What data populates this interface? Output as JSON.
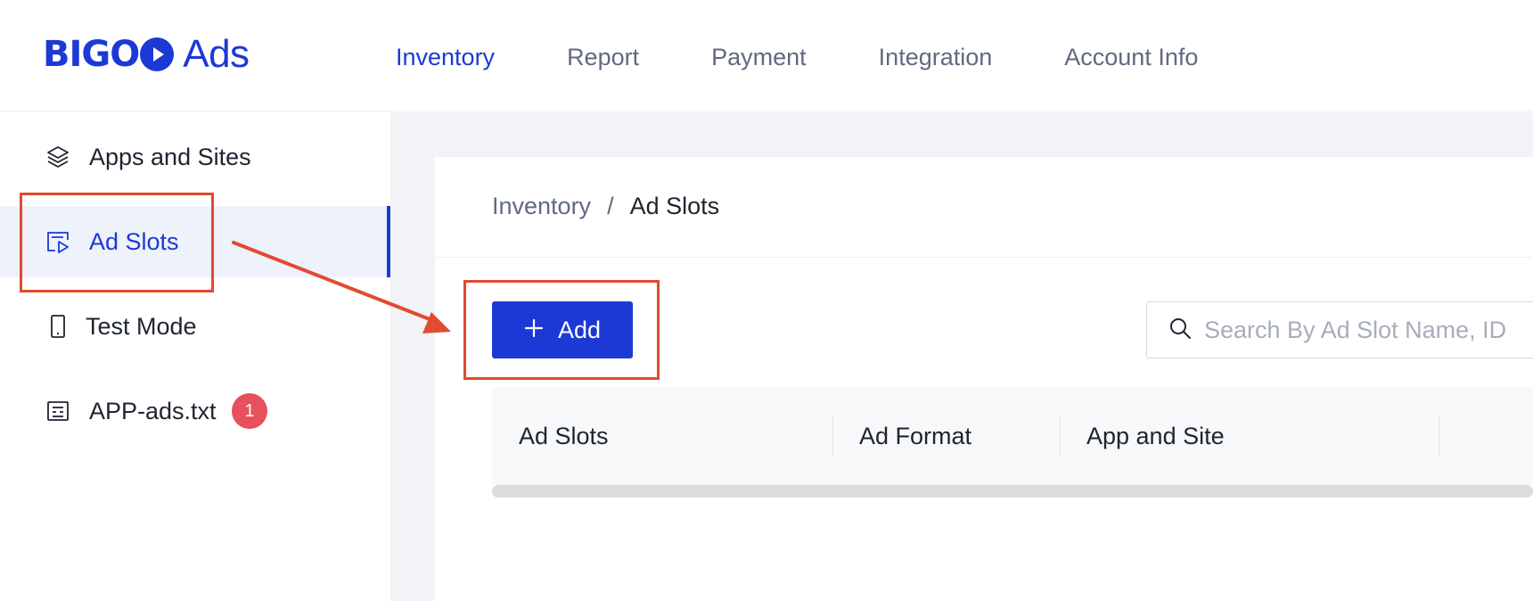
{
  "brand": {
    "logo_text_1": "BIGO",
    "logo_text_2": "Ads"
  },
  "nav": {
    "items": [
      {
        "label": "Inventory",
        "active": true
      },
      {
        "label": "Report",
        "active": false
      },
      {
        "label": "Payment",
        "active": false
      },
      {
        "label": "Integration",
        "active": false
      },
      {
        "label": "Account Info",
        "active": false
      }
    ]
  },
  "sidebar": {
    "items": [
      {
        "label": "Apps and Sites",
        "icon": "layers-icon",
        "active": false
      },
      {
        "label": "Ad Slots",
        "icon": "ad-slot-icon",
        "active": true
      },
      {
        "label": "Test Mode",
        "icon": "phone-icon",
        "active": false
      },
      {
        "label": "APP-ads.txt",
        "icon": "file-list-icon",
        "active": false,
        "badge": "1"
      }
    ]
  },
  "breadcrumb": {
    "parent": "Inventory",
    "separator": "/",
    "current": "Ad Slots"
  },
  "toolbar": {
    "add_label": "Add",
    "search_placeholder": "Search By Ad Slot Name, ID"
  },
  "table": {
    "columns": [
      "Ad Slots",
      "Ad Format",
      "App and Site"
    ]
  },
  "colors": {
    "accent": "#1c39d6",
    "annotation": "#e14b2f",
    "badge": "#e8505b"
  }
}
